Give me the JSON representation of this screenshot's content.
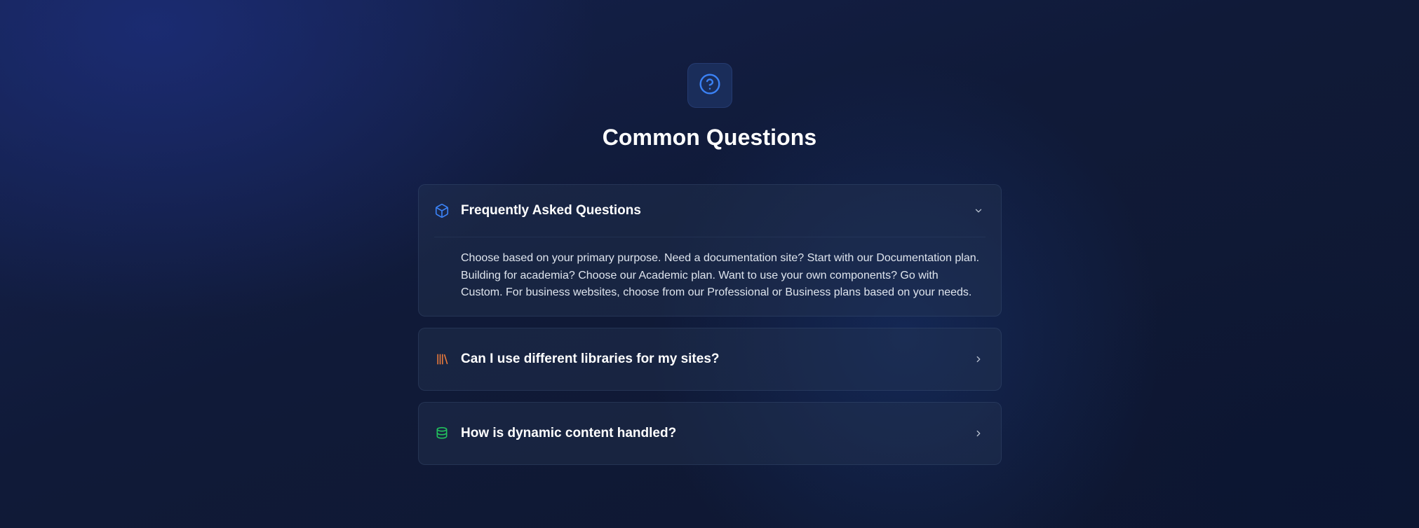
{
  "hero": {
    "icon": "question-circle-icon",
    "title": "Common Questions"
  },
  "faq": {
    "items": [
      {
        "icon": "cube-icon",
        "icon_color": "#3b82f6",
        "question": "Frequently Asked Questions",
        "expanded": true,
        "answer": "Choose based on your primary purpose. Need a documentation site? Start with our Documentation plan. Building for academia? Choose our Academic plan. Want to use your own components? Go with Custom. For business websites, choose from our Professional or Business plans based on your needs."
      },
      {
        "icon": "library-icon",
        "icon_color": "#ea7a3b",
        "question": "Can I use different libraries for my sites?",
        "expanded": false
      },
      {
        "icon": "database-icon",
        "icon_color": "#22c55e",
        "question": "How is dynamic content handled?",
        "expanded": false
      }
    ]
  },
  "colors": {
    "accent": "#3b82f6",
    "background": "#101a38"
  }
}
